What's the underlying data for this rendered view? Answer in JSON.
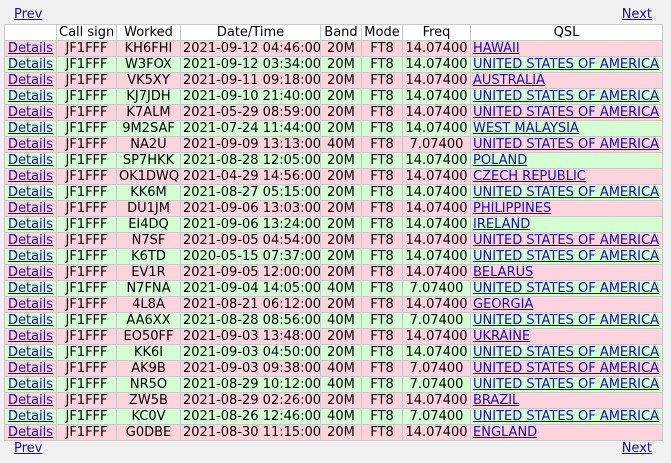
{
  "nav": {
    "prev_label": "Prev",
    "next_label": "Next"
  },
  "headers": [
    "",
    "Call sign",
    "Worked",
    "Date/Time",
    "Band",
    "Mode",
    "Freq",
    "QSL"
  ],
  "rows": [
    {
      "details": "Details",
      "call": "JF1FFF",
      "worked": "KH6FHI",
      "datetime": "2021-09-12 04:46:00",
      "band": "20M",
      "mode": "FT8",
      "freq": "14.07400",
      "qsl": "HAWAII",
      "color": "pink"
    },
    {
      "details": "Details",
      "call": "JF1FFF",
      "worked": "W3FOX",
      "datetime": "2021-09-12 03:34:00",
      "band": "20M",
      "mode": "FT8",
      "freq": "14.07400",
      "qsl": "UNITED STATES OF AMERICA",
      "color": "green"
    },
    {
      "details": "Details",
      "call": "JF1FFF",
      "worked": "VK5XY",
      "datetime": "2021-09-11 09:18:00",
      "band": "20M",
      "mode": "FT8",
      "freq": "14.07400",
      "qsl": "AUSTRALIA",
      "color": "pink"
    },
    {
      "details": "Details",
      "call": "JF1FFF",
      "worked": "KJ7JDH",
      "datetime": "2021-09-10 21:40:00",
      "band": "20M",
      "mode": "FT8",
      "freq": "14.07400",
      "qsl": "UNITED STATES OF AMERICA",
      "color": "green"
    },
    {
      "details": "Details",
      "call": "JF1FFF",
      "worked": "K7ALM",
      "datetime": "2021-05-29 08:59:00",
      "band": "20M",
      "mode": "FT8",
      "freq": "14.07400",
      "qsl": "UNITED STATES OF AMERICA",
      "color": "pink"
    },
    {
      "details": "Details",
      "call": "JF1FFF",
      "worked": "9M2SAF",
      "datetime": "2021-07-24 11:44:00",
      "band": "20M",
      "mode": "FT8",
      "freq": "14.07400",
      "qsl": "WEST MALAYSIA",
      "color": "green"
    },
    {
      "details": "Details",
      "call": "JF1FFF",
      "worked": "NA2U",
      "datetime": "2021-09-09 13:13:00",
      "band": "40M",
      "mode": "FT8",
      "freq": "7.07400",
      "qsl": "UNITED STATES OF AMERICA",
      "color": "pink"
    },
    {
      "details": "Details",
      "call": "JF1FFF",
      "worked": "SP7HKK",
      "datetime": "2021-08-28 12:05:00",
      "band": "20M",
      "mode": "FT8",
      "freq": "14.07400",
      "qsl": "POLAND",
      "color": "green"
    },
    {
      "details": "Details",
      "call": "JF1FFF",
      "worked": "OK1DWQ",
      "datetime": "2021-04-29 14:56:00",
      "band": "20M",
      "mode": "FT8",
      "freq": "14.07400",
      "qsl": "CZECH REPUBLIC",
      "color": "pink"
    },
    {
      "details": "Details",
      "call": "JF1FFF",
      "worked": "KK6M",
      "datetime": "2021-08-27 05:15:00",
      "band": "20M",
      "mode": "FT8",
      "freq": "14.07400",
      "qsl": "UNITED STATES OF AMERICA",
      "color": "green"
    },
    {
      "details": "Details",
      "call": "JF1FFF",
      "worked": "DU1JM",
      "datetime": "2021-09-06 13:03:00",
      "band": "20M",
      "mode": "FT8",
      "freq": "14.07400",
      "qsl": "PHILIPPINES",
      "color": "pink"
    },
    {
      "details": "Details",
      "call": "JF1FFF",
      "worked": "EI4DQ",
      "datetime": "2021-09-06 13:24:00",
      "band": "20M",
      "mode": "FT8",
      "freq": "14.07400",
      "qsl": "IRELAND",
      "color": "green"
    },
    {
      "details": "Details",
      "call": "JF1FFF",
      "worked": "N7SF",
      "datetime": "2021-09-05 04:54:00",
      "band": "20M",
      "mode": "FT8",
      "freq": "14.07400",
      "qsl": "UNITED STATES OF AMERICA",
      "color": "pink"
    },
    {
      "details": "Details",
      "call": "JF1FFF",
      "worked": "K6TD",
      "datetime": "2020-05-15 07:37:00",
      "band": "20M",
      "mode": "FT8",
      "freq": "14.07400",
      "qsl": "UNITED STATES OF AMERICA",
      "color": "green"
    },
    {
      "details": "Details",
      "call": "JF1FFF",
      "worked": "EV1R",
      "datetime": "2021-09-05 12:00:00",
      "band": "20M",
      "mode": "FT8",
      "freq": "14.07400",
      "qsl": "BELARUS",
      "color": "pink"
    },
    {
      "details": "Details",
      "call": "JF1FFF",
      "worked": "N7FNA",
      "datetime": "2021-09-04 14:05:00",
      "band": "40M",
      "mode": "FT8",
      "freq": "7.07400",
      "qsl": "UNITED STATES OF AMERICA",
      "color": "green"
    },
    {
      "details": "Details",
      "call": "JF1FFF",
      "worked": "4L8A",
      "datetime": "2021-08-21 06:12:00",
      "band": "20M",
      "mode": "FT8",
      "freq": "14.07400",
      "qsl": "GEORGIA",
      "color": "pink"
    },
    {
      "details": "Details",
      "call": "JF1FFF",
      "worked": "AA6XX",
      "datetime": "2021-08-28 08:56:00",
      "band": "40M",
      "mode": "FT8",
      "freq": "7.07400",
      "qsl": "UNITED STATES OF AMERICA",
      "color": "green"
    },
    {
      "details": "Details",
      "call": "JF1FFF",
      "worked": "EO50FF",
      "datetime": "2021-09-03 13:48:00",
      "band": "20M",
      "mode": "FT8",
      "freq": "14.07400",
      "qsl": "UKRAINE",
      "color": "pink"
    },
    {
      "details": "Details",
      "call": "JF1FFF",
      "worked": "KK6I",
      "datetime": "2021-09-03 04:50:00",
      "band": "20M",
      "mode": "FT8",
      "freq": "14.07400",
      "qsl": "UNITED STATES OF AMERICA",
      "color": "green"
    },
    {
      "details": "Details",
      "call": "JF1FFF",
      "worked": "AK9B",
      "datetime": "2021-09-03 09:38:00",
      "band": "40M",
      "mode": "FT8",
      "freq": "7.07400",
      "qsl": "UNITED STATES OF AMERICA",
      "color": "pink"
    },
    {
      "details": "Details",
      "call": "JF1FFF",
      "worked": "NR5O",
      "datetime": "2021-08-29 10:12:00",
      "band": "40M",
      "mode": "FT8",
      "freq": "7.07400",
      "qsl": "UNITED STATES OF AMERICA",
      "color": "green"
    },
    {
      "details": "Details",
      "call": "JF1FFF",
      "worked": "ZW5B",
      "datetime": "2021-08-29 02:26:00",
      "band": "20M",
      "mode": "FT8",
      "freq": "14.07400",
      "qsl": "BRAZIL",
      "color": "pink"
    },
    {
      "details": "Details",
      "call": "JF1FFF",
      "worked": "KC0V",
      "datetime": "2021-08-26 12:46:00",
      "band": "40M",
      "mode": "FT8",
      "freq": "7.07400",
      "qsl": "UNITED STATES OF AMERICA",
      "color": "green"
    },
    {
      "details": "Details",
      "call": "JF1FFF",
      "worked": "G0DBE",
      "datetime": "2021-08-30 11:15:00",
      "band": "20M",
      "mode": "FT8",
      "freq": "14.07400",
      "qsl": "ENGLAND",
      "color": "pink"
    }
  ],
  "colors": {
    "pink_row": "#ffd3de",
    "green_row": "#d3ffd3",
    "link": "#1a0dab"
  }
}
